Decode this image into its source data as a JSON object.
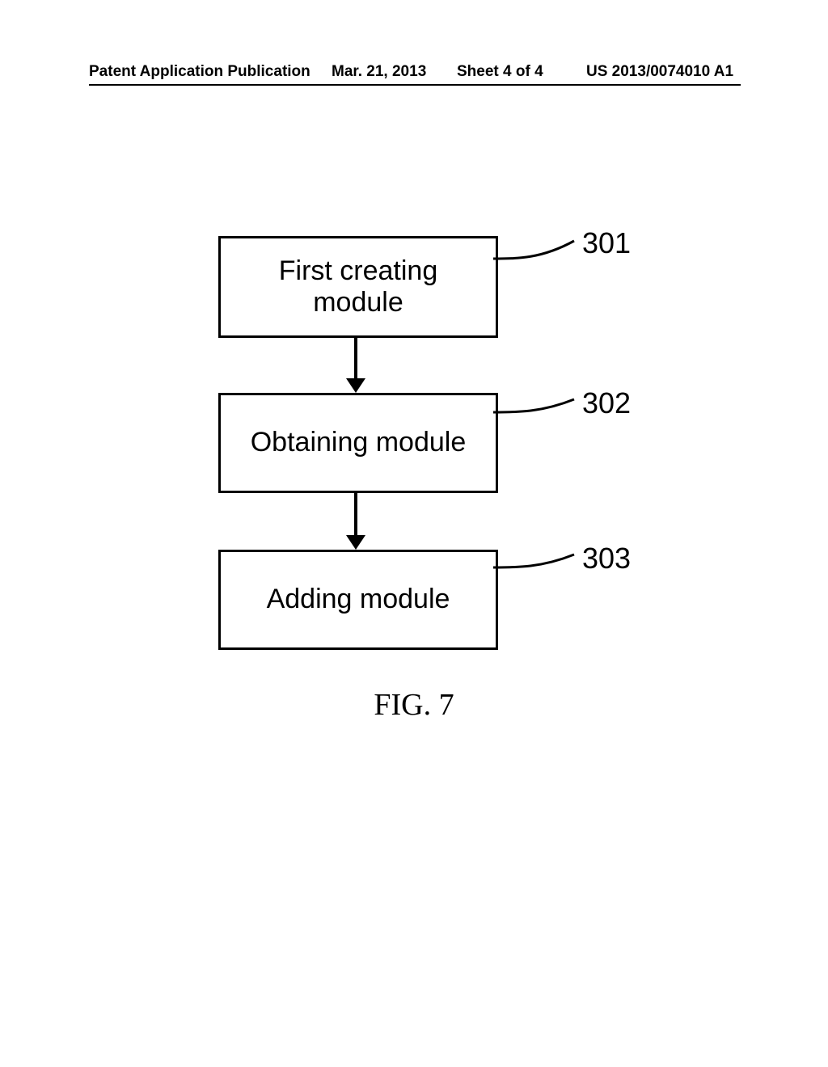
{
  "header": {
    "publication_type": "Patent Application Publication",
    "date": "Mar. 21, 2013",
    "sheet": "Sheet 4 of 4",
    "pub_number": "US 2013/0074010 A1"
  },
  "diagram": {
    "boxes": {
      "first_creating": {
        "label": "First creating\nmodule",
        "ref": "301"
      },
      "obtaining": {
        "label": "Obtaining module",
        "ref": "302"
      },
      "adding": {
        "label": "Adding module",
        "ref": "303"
      }
    },
    "caption": "FIG. 7"
  }
}
